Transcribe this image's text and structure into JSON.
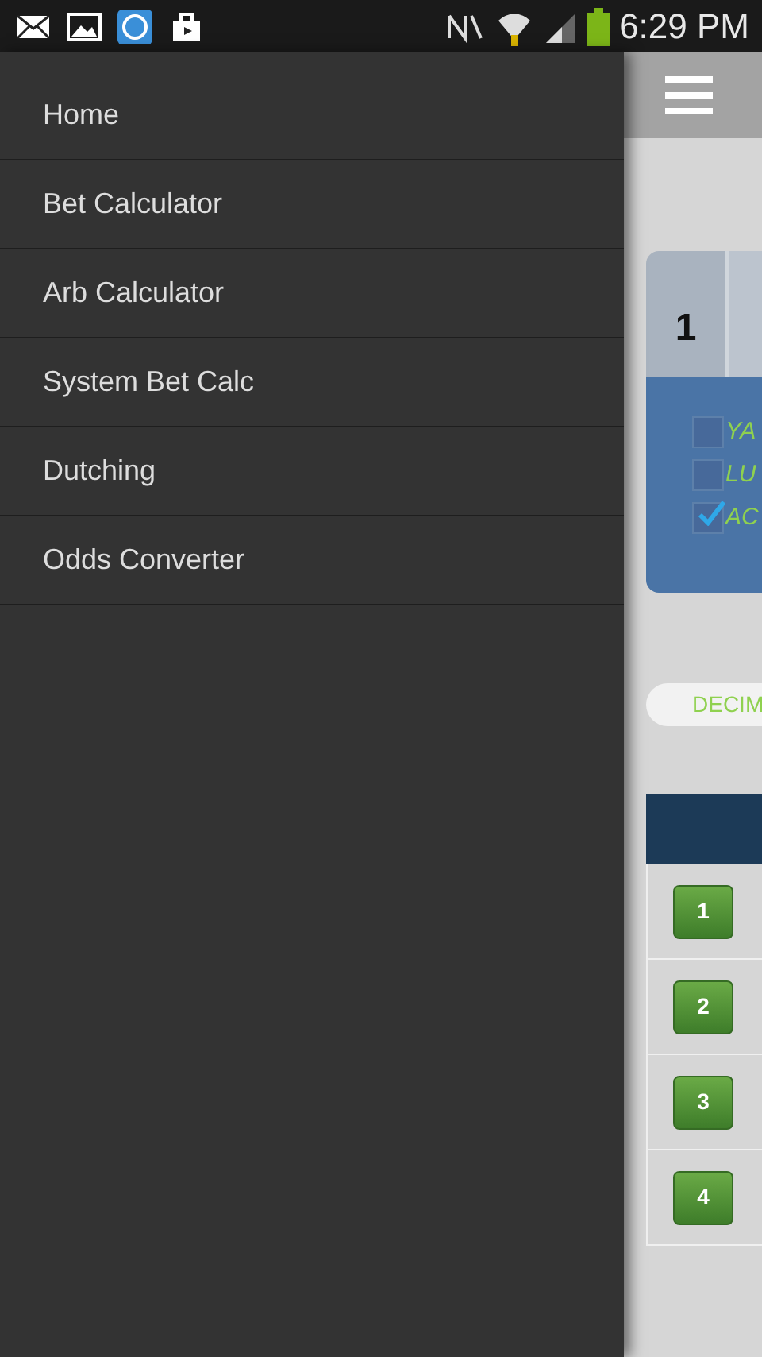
{
  "status_bar": {
    "time": "6:29 PM"
  },
  "drawer": {
    "items": [
      {
        "label": "Home"
      },
      {
        "label": "Bet Calculator"
      },
      {
        "label": "Arb Calculator"
      },
      {
        "label": "System Bet Calc"
      },
      {
        "label": "Dutching"
      },
      {
        "label": "Odds Converter"
      }
    ]
  },
  "tabs": [
    {
      "label": "1",
      "selected": true
    },
    {
      "selected": false
    }
  ],
  "options": [
    {
      "label": "YA",
      "checked": false
    },
    {
      "label": "LU",
      "checked": false
    },
    {
      "label": "AC",
      "checked": true
    }
  ],
  "odds_format": {
    "label": "DECIM"
  },
  "table": {
    "rows": [
      {
        "button": "1"
      },
      {
        "button": "2"
      },
      {
        "button": "3"
      },
      {
        "button": "4"
      }
    ]
  }
}
